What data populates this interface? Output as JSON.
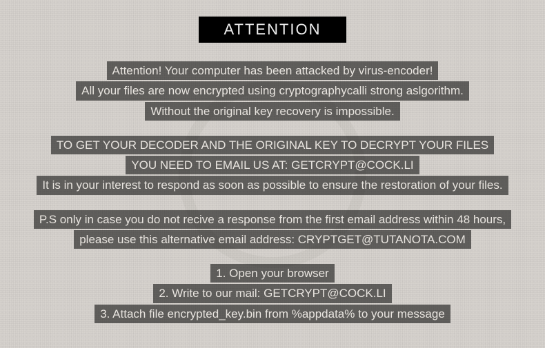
{
  "title": "ATTENTION",
  "para1": {
    "l1": "Attention! Your computer has been attacked by virus-encoder!",
    "l2": "All your files are now encrypted using cryptographycalli strong aslgorithm.",
    "l3": "Without the original key recovery is impossible."
  },
  "para2": {
    "l1": "TO GET YOUR DECODER AND THE ORIGINAL KEY TO DECRYPT YOUR FILES",
    "l2": "YOU NEED TO EMAIL US AT: GETCRYPT@COCK.LI",
    "l3": "It is in your interest to respond as soon as possible to ensure the restoration of your files."
  },
  "para3": {
    "l1": "P.S only in case you do not recive a response from the first email address within 48 hours,",
    "l2": "please use this alternative email address: CRYPTGET@TUTANOTA.COM"
  },
  "steps": {
    "l1": "1. Open your browser",
    "l2": "2. Write to our mail: GETCRYPT@COCK.LI",
    "l3": "3. Attach file encrypted_key.bin from %appdata% to your message"
  }
}
